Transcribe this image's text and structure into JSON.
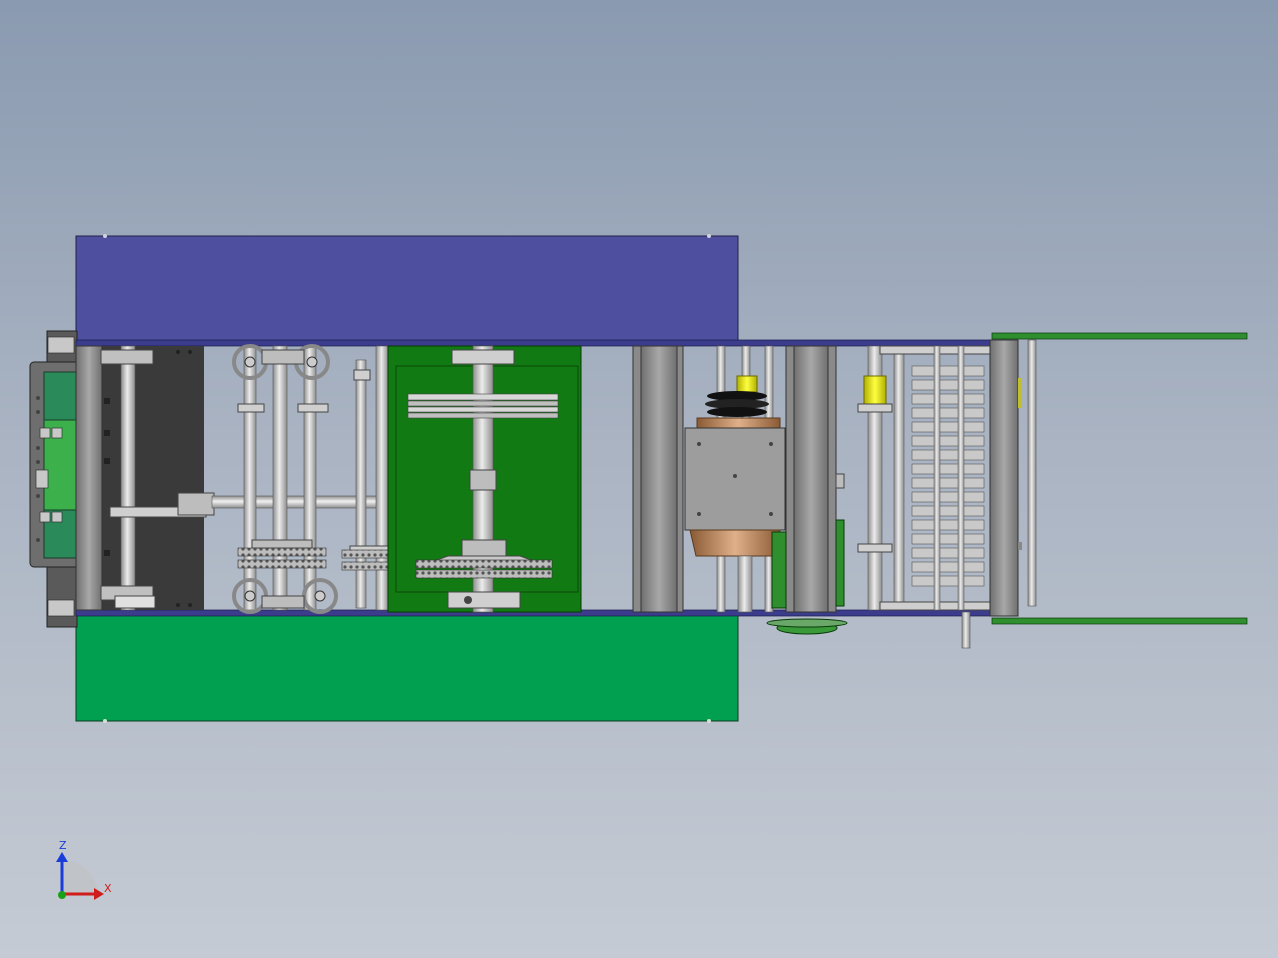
{
  "viewport": {
    "background_top": "#8a9ab0",
    "background_bottom": "#c5cbd4"
  },
  "colors": {
    "top_cover": "#4f4f9f",
    "bottom_cover": "#00a050",
    "frame_rail": "#3c3c8c",
    "green_plate": "#127a12",
    "dark_plate": "#3a3a3a",
    "shaft": "#c6c6c6",
    "steel": "#9a9a9a",
    "yellow_collar": "#e6e600",
    "copper_hopper": "#c08a5a",
    "green_arm": "#2f8f2f"
  },
  "orientation_triad": {
    "axis_z_label": "Z",
    "axis_x_label": "X",
    "axis_z_color": "#1a3cd8",
    "axis_x_color": "#d01c1c",
    "origin_color": "#18a018"
  }
}
